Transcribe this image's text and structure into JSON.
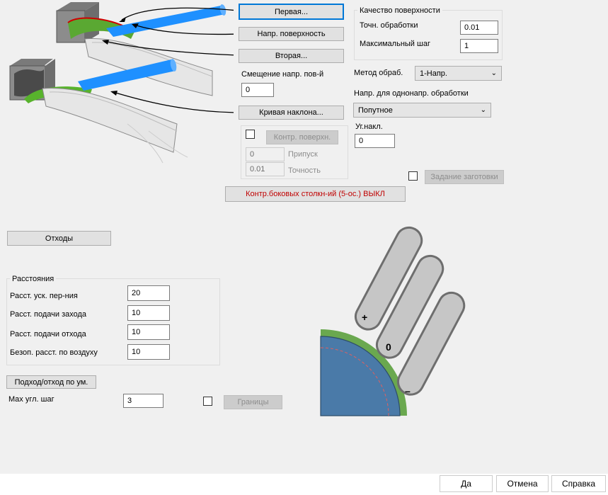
{
  "top_buttons": {
    "first": "Первая...",
    "surface_dir": "Напр. поверхность",
    "second": "Вторая...",
    "tilt_curve": "Кривая наклона..."
  },
  "offset": {
    "label": "Смещение напр. пов-й",
    "value": "0"
  },
  "check_surface": {
    "button": "Контр. поверхн.",
    "allowance_value": "0",
    "allowance_label": "Припуск",
    "tolerance_value": "0.01",
    "tolerance_label": "Точность"
  },
  "collision_button": "Контр.боковых столкн-ий (5-ос.) ВЫКЛ",
  "surface_quality": {
    "title": "Качество поверхности",
    "tolerance_label": "Точн. обработки",
    "tolerance_value": "0.01",
    "max_step_label": "Максимальный шаг",
    "max_step_value": "1"
  },
  "method": {
    "label": "Метод обраб.",
    "value": "1-Напр."
  },
  "one_way": {
    "label": "Напр. для однонапр. обработки",
    "value": "Попутное"
  },
  "tilt_angle": {
    "label": "Уг.накл.",
    "value": "0"
  },
  "stock_button": "Задание заготовки",
  "retract_button": "Отходы",
  "distances": {
    "title": "Расстояния",
    "rows": [
      {
        "label": "Расст. уск. пер-ния",
        "value": "20"
      },
      {
        "label": "Расст. подачи захода",
        "value": "10"
      },
      {
        "label": "Расст. подачи отхода",
        "value": "10"
      },
      {
        "label": "Безоп. расст. по воздуху",
        "value": "10"
      }
    ]
  },
  "approach_button": "Подход/отход по ум.",
  "max_angle_step": {
    "label": "Max угл. шаг",
    "value": "3"
  },
  "bounds_button": "Границы",
  "illustration": {
    "plus": "+",
    "zero": "0",
    "minus": "–"
  },
  "footer": {
    "ok": "Да",
    "cancel": "Отмена",
    "help": "Справка"
  },
  "colors": {
    "focus": "#0078d7",
    "accent_text": "#c00000",
    "surface_green": "#6aa84f",
    "surface_blue": "#4a7aa8"
  }
}
